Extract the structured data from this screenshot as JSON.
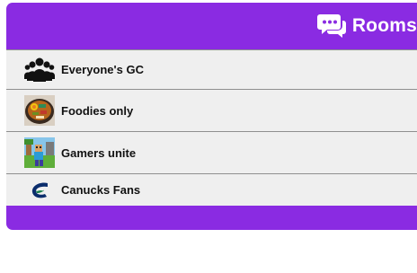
{
  "header": {
    "title": "Rooms",
    "icon": "chat-bubbles-icon"
  },
  "rooms": [
    {
      "name": "Everyone's GC",
      "icon": "group-people-icon"
    },
    {
      "name": "Foodies only",
      "icon": "food-bowl-image"
    },
    {
      "name": "Gamers unite",
      "icon": "game-scene-image"
    },
    {
      "name": "Canucks Fans",
      "icon": "canucks-logo"
    }
  ],
  "colors": {
    "accent": "#8a2be2",
    "list_bg": "#efefef",
    "divider": "#8f8f8f",
    "header_text": "#ffffff"
  }
}
